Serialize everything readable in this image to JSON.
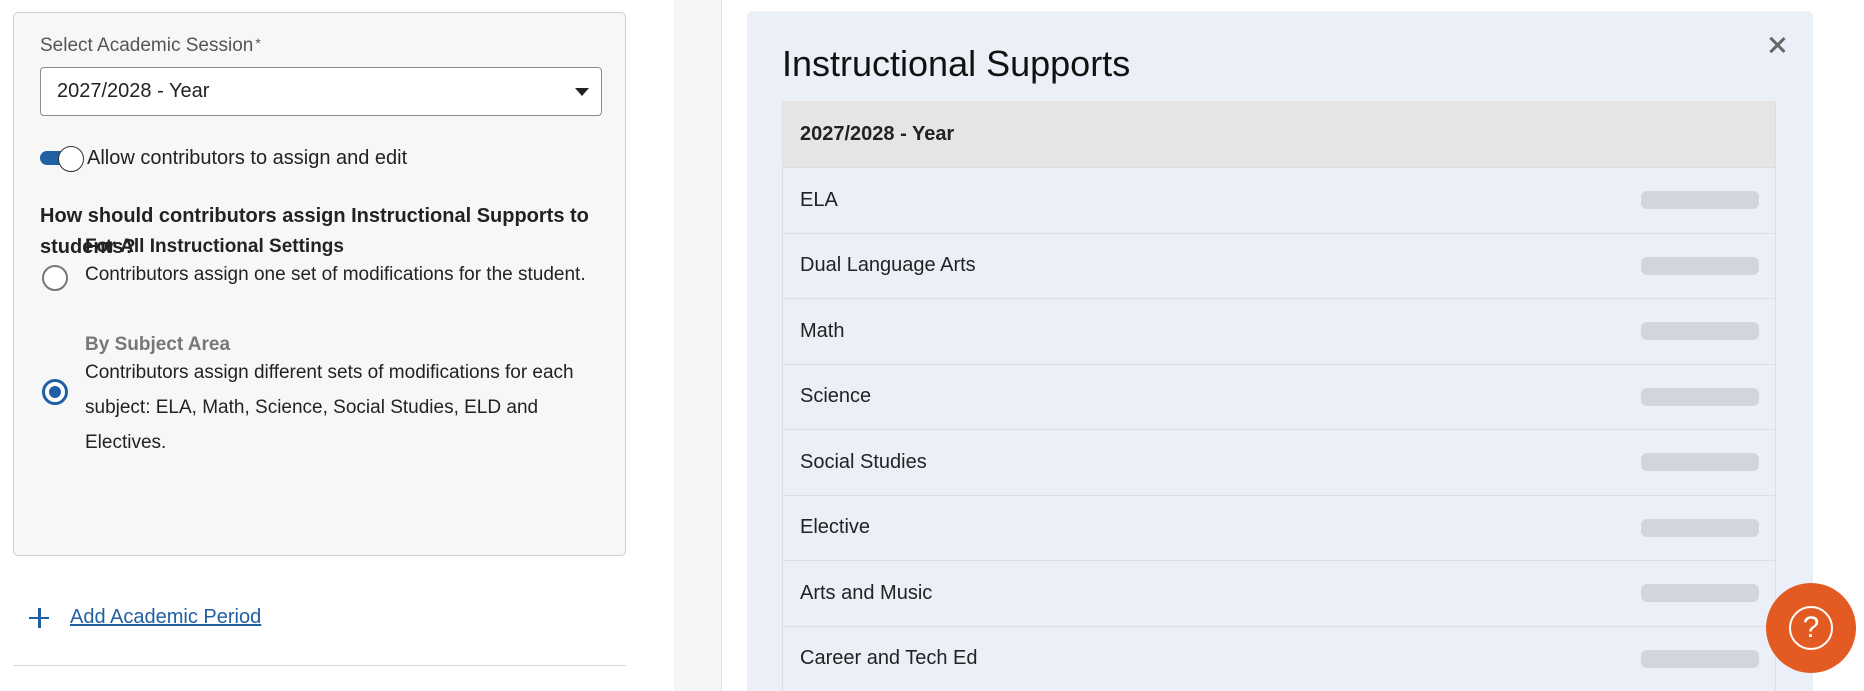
{
  "session": {
    "label": "Select Academic Session",
    "required_mark": "*",
    "selected": "2027/2028 - Year"
  },
  "toggle": {
    "label": "Allow contributors to assign and edit",
    "state": "on"
  },
  "question": "How should contributors assign Instructional Supports to students?",
  "options": [
    {
      "title": "For All Instructional Settings",
      "description": "Contributors assign one set of modifications for the student.",
      "selected": false
    },
    {
      "title": "By Subject Area",
      "description": "Contributors assign different sets of modifications for each subject: ELA, Math, Science, Social Studies, ELD and Electives.",
      "selected": true
    }
  ],
  "add_period": {
    "label": "Add Academic Period"
  },
  "panel": {
    "title": "Instructional Supports",
    "table_header": "2027/2028 - Year",
    "subjects": [
      "ELA",
      "Dual Language Arts",
      "Math",
      "Science",
      "Social Studies",
      "Elective",
      "Arts and Music",
      "Career and Tech Ed"
    ]
  },
  "colors": {
    "accent": "#1f5fa3",
    "panel_bg": "#ebf0f8",
    "help_button": "#e35a22"
  },
  "icons": [
    "caret-down-icon",
    "plus-icon",
    "close-icon",
    "help-icon"
  ]
}
